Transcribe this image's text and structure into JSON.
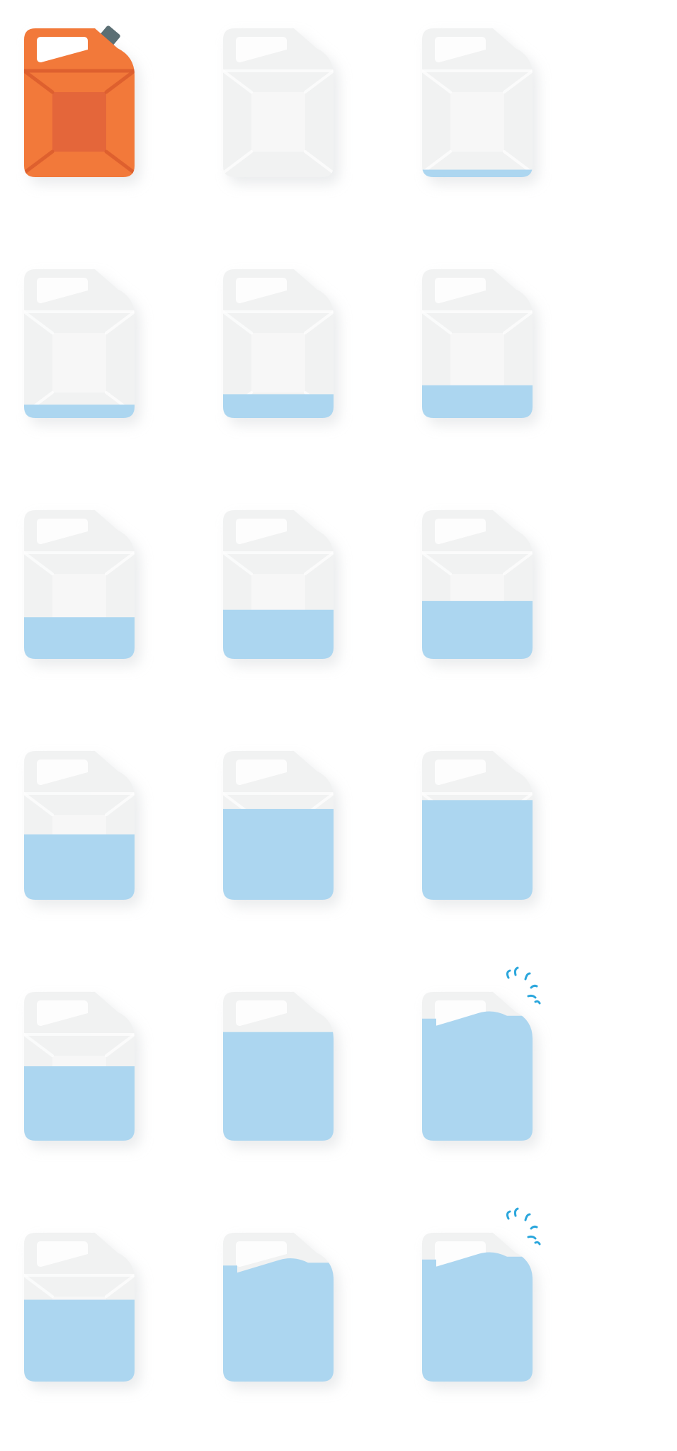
{
  "colors": {
    "background": "#ffffff",
    "can_body": "#f1f2f2",
    "can_panel": "#f7f7f7",
    "can_handle": "#ffffff",
    "water": "#acd6f0",
    "splash": "#2aa6dc",
    "orange_body": "#f2793a",
    "orange_panel": "#e4663a",
    "orange_emboss": "#dc5e2e",
    "cap": "#5b6f74",
    "shadow": "#d9dcde"
  },
  "sprites": [
    {
      "variant": "orange",
      "fill_level": 0,
      "splash": false
    },
    {
      "variant": "empty",
      "fill_level": 0.0,
      "splash": false
    },
    {
      "variant": "empty",
      "fill_level": 0.05,
      "splash": false
    },
    {
      "variant": "empty",
      "fill_level": 0.09,
      "splash": false
    },
    {
      "variant": "empty",
      "fill_level": 0.16,
      "splash": false
    },
    {
      "variant": "empty",
      "fill_level": 0.22,
      "splash": false
    },
    {
      "variant": "empty",
      "fill_level": 0.28,
      "splash": false
    },
    {
      "variant": "empty",
      "fill_level": 0.33,
      "splash": false
    },
    {
      "variant": "empty",
      "fill_level": 0.39,
      "splash": false
    },
    {
      "variant": "empty",
      "fill_level": 0.44,
      "splash": false
    },
    {
      "variant": "empty",
      "fill_level": 0.61,
      "splash": false
    },
    {
      "variant": "empty",
      "fill_level": 0.67,
      "splash": false
    },
    {
      "variant": "empty",
      "fill_level": 0.5,
      "splash": false
    },
    {
      "variant": "empty",
      "fill_level": 0.73,
      "splash": false
    },
    {
      "variant": "empty",
      "fill_level": 0.82,
      "splash": true
    },
    {
      "variant": "empty",
      "fill_level": 0.55,
      "splash": false
    },
    {
      "variant": "empty",
      "fill_level": 0.78,
      "splash": false
    },
    {
      "variant": "empty",
      "fill_level": 0.82,
      "splash": true
    }
  ]
}
